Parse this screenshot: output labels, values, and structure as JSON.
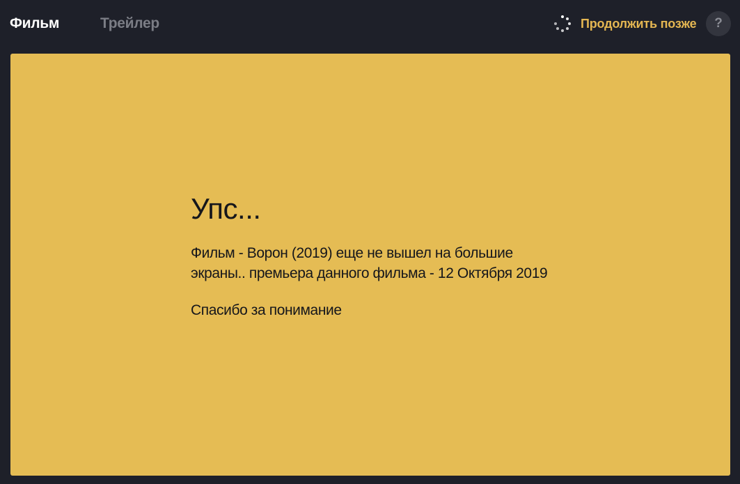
{
  "tabs": [
    {
      "label": "Фильм",
      "active": true
    },
    {
      "label": "Трейлер",
      "active": false
    }
  ],
  "header": {
    "continue_label": "Продолжить позже",
    "continue_icon": "loading-spinner-icon",
    "help_label": "?"
  },
  "message": {
    "title": "Упс...",
    "body": "Фильм - Ворон (2019) еще не вышел на большие экраны.. премьера данного фильма - 12 Октября 2019",
    "thanks": "Спасибо за понимание"
  },
  "colors": {
    "background": "#1e2029",
    "accent": "#e5b752",
    "player_bg": "#e5bc54",
    "inactive_tab": "#7b7d85",
    "help_bg": "#33353e"
  }
}
